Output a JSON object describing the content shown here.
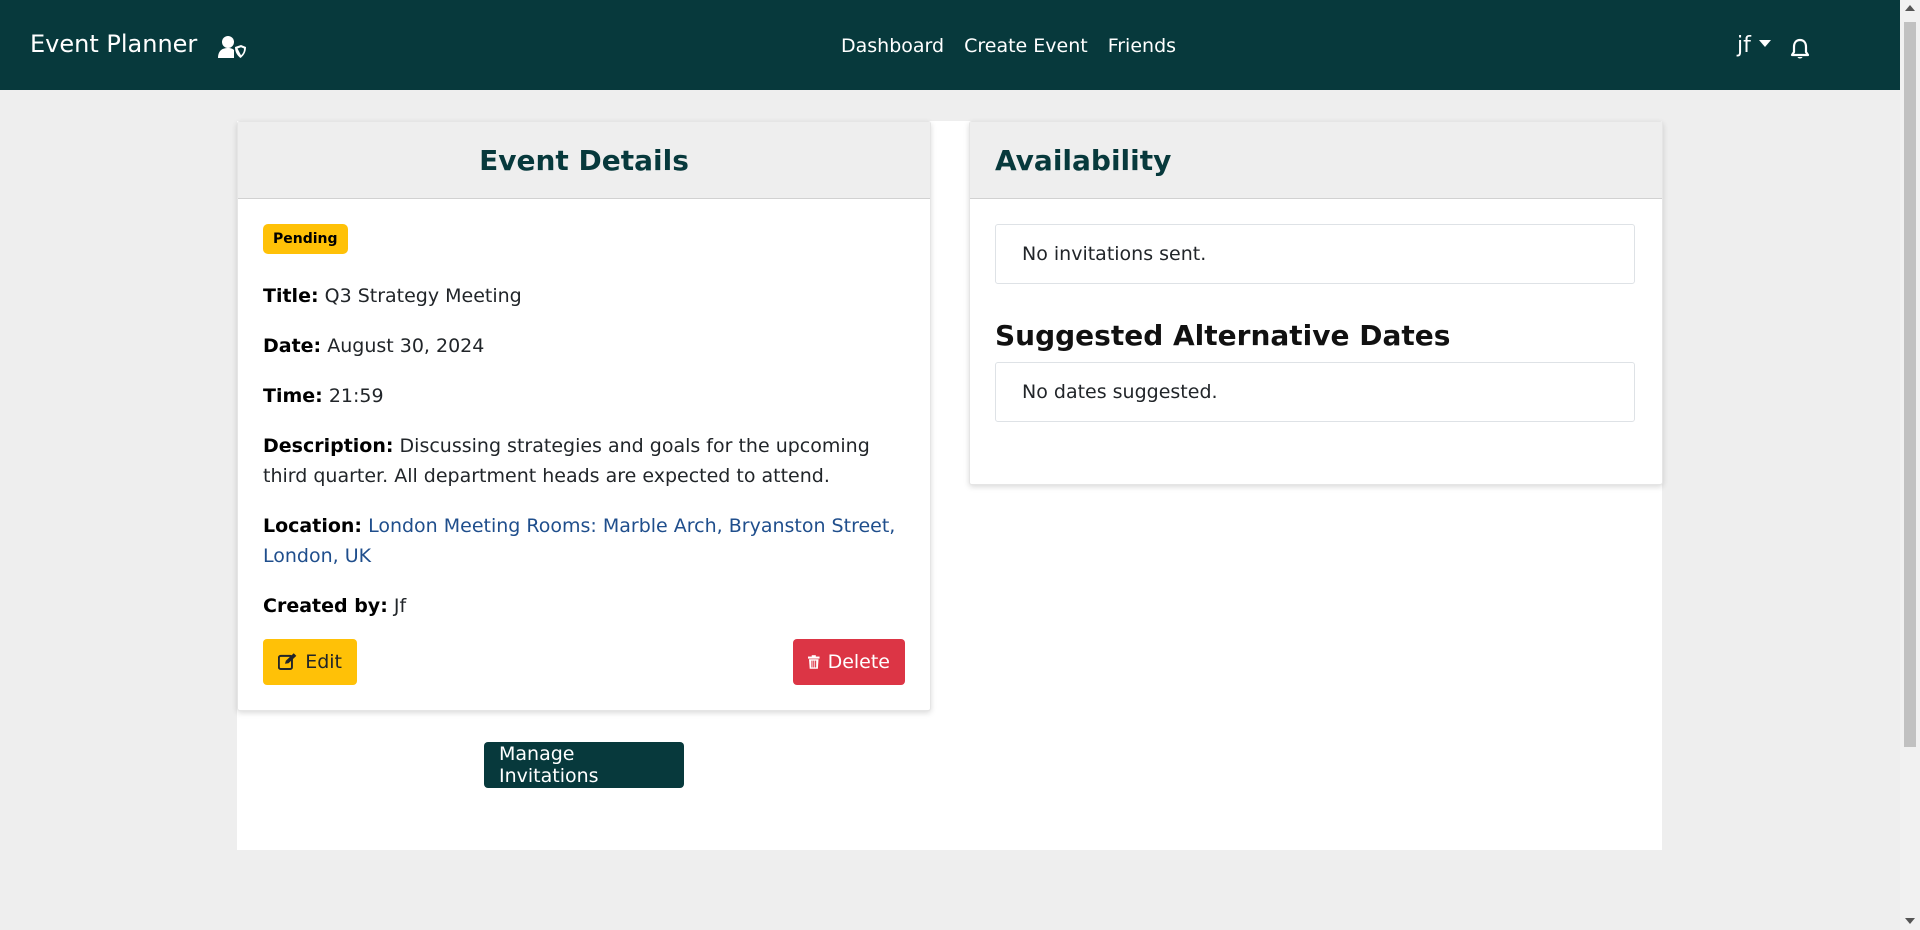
{
  "navbar": {
    "brand": "Event Planner",
    "brand_icon": "user-shield-icon",
    "links": [
      "Dashboard",
      "Create Event",
      "Friends"
    ],
    "user": "jf",
    "notification_icon": "bell-icon",
    "bg_color": "#07393c"
  },
  "event_card": {
    "header": "Event Details",
    "status": "Pending",
    "title_label": "Title:",
    "title_value": "Q3 Strategy Meeting",
    "date_label": "Date:",
    "date_value": "August 30, 2024",
    "time_label": "Time:",
    "time_value": "21:59",
    "description_label": "Description:",
    "description_value": "Discussing strategies and goals for the upcoming third quarter. All department heads are expected to attend.",
    "location_label": "Location:",
    "location_value": "London Meeting Rooms: Marble Arch, Bryanston Street, London, UK",
    "created_label": "Created by:",
    "created_value": "Jf",
    "edit_label": "Edit",
    "delete_label": "Delete"
  },
  "manage_button": "Manage Invitations",
  "availability_card": {
    "header": "Availability",
    "invitations_text": "No invitations sent.",
    "suggested_heading": "Suggested Alternative Dates",
    "suggested_text": "No dates suggested."
  },
  "colors": {
    "warning": "#ffc107",
    "danger": "#dc3545",
    "link": "#1f4e8c"
  }
}
